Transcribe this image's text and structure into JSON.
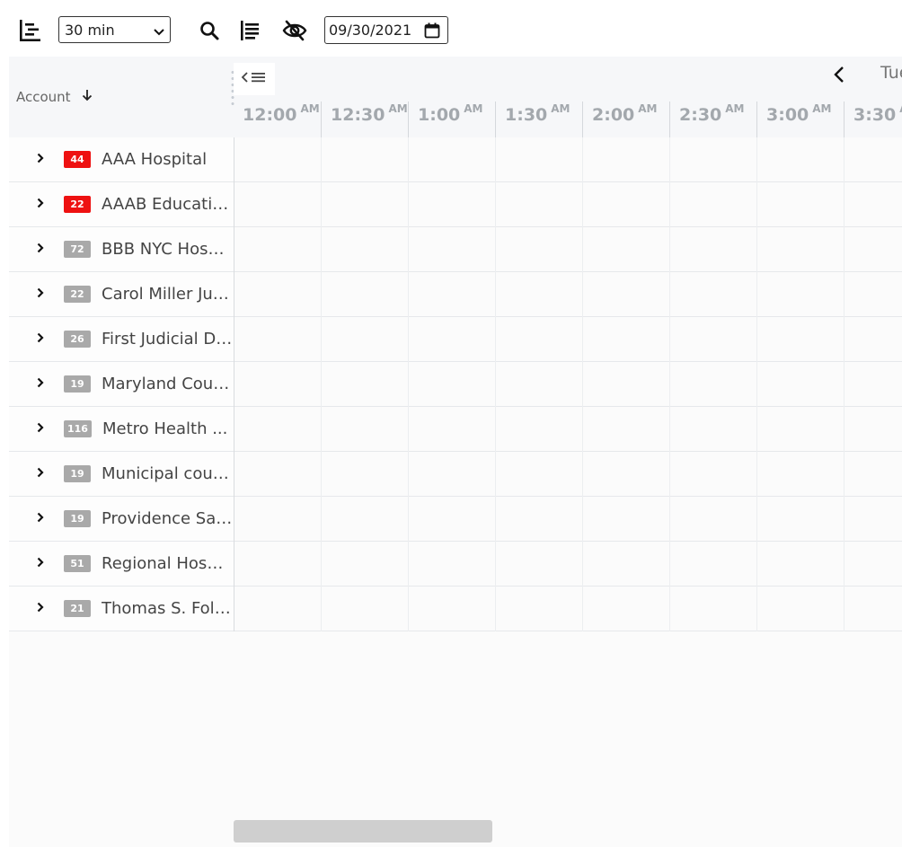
{
  "toolbar": {
    "timescale": "30 min",
    "date": "09/30/2021"
  },
  "grid": {
    "account_header": "Account",
    "day_label": "Tue",
    "times": [
      {
        "t": "12:00",
        "p": "AM"
      },
      {
        "t": "12:30",
        "p": "AM"
      },
      {
        "t": "1:00",
        "p": "AM"
      },
      {
        "t": "1:30",
        "p": "AM"
      },
      {
        "t": "2:00",
        "p": "AM"
      },
      {
        "t": "2:30",
        "p": "AM"
      },
      {
        "t": "3:00",
        "p": "AM"
      },
      {
        "t": "3:30",
        "p": "AM"
      }
    ],
    "rows": [
      {
        "count": "44",
        "color": "red",
        "name": "AAA Hospital"
      },
      {
        "count": "22",
        "color": "red",
        "name": "AAAB Educatio..."
      },
      {
        "count": "72",
        "color": "gray",
        "name": "BBB NYC Hospi..."
      },
      {
        "count": "22",
        "color": "gray",
        "name": "Carol Miller Jus..."
      },
      {
        "count": "26",
        "color": "gray",
        "name": "First Judicial Dis..."
      },
      {
        "count": "19",
        "color": "gray",
        "name": "Maryland Courts"
      },
      {
        "count": "116",
        "color": "gray",
        "name": "Metro Health ..."
      },
      {
        "count": "19",
        "color": "gray",
        "name": "Municipal court..."
      },
      {
        "count": "19",
        "color": "gray",
        "name": "Providence Sacr..."
      },
      {
        "count": "51",
        "color": "gray",
        "name": "Regional Hospital"
      },
      {
        "count": "21",
        "color": "gray",
        "name": "Thomas S. Fole..."
      }
    ]
  },
  "colors": {
    "badge_red": "#ee1111",
    "badge_gray": "#a9a9a9",
    "header_bg": "#f6f7f9"
  }
}
